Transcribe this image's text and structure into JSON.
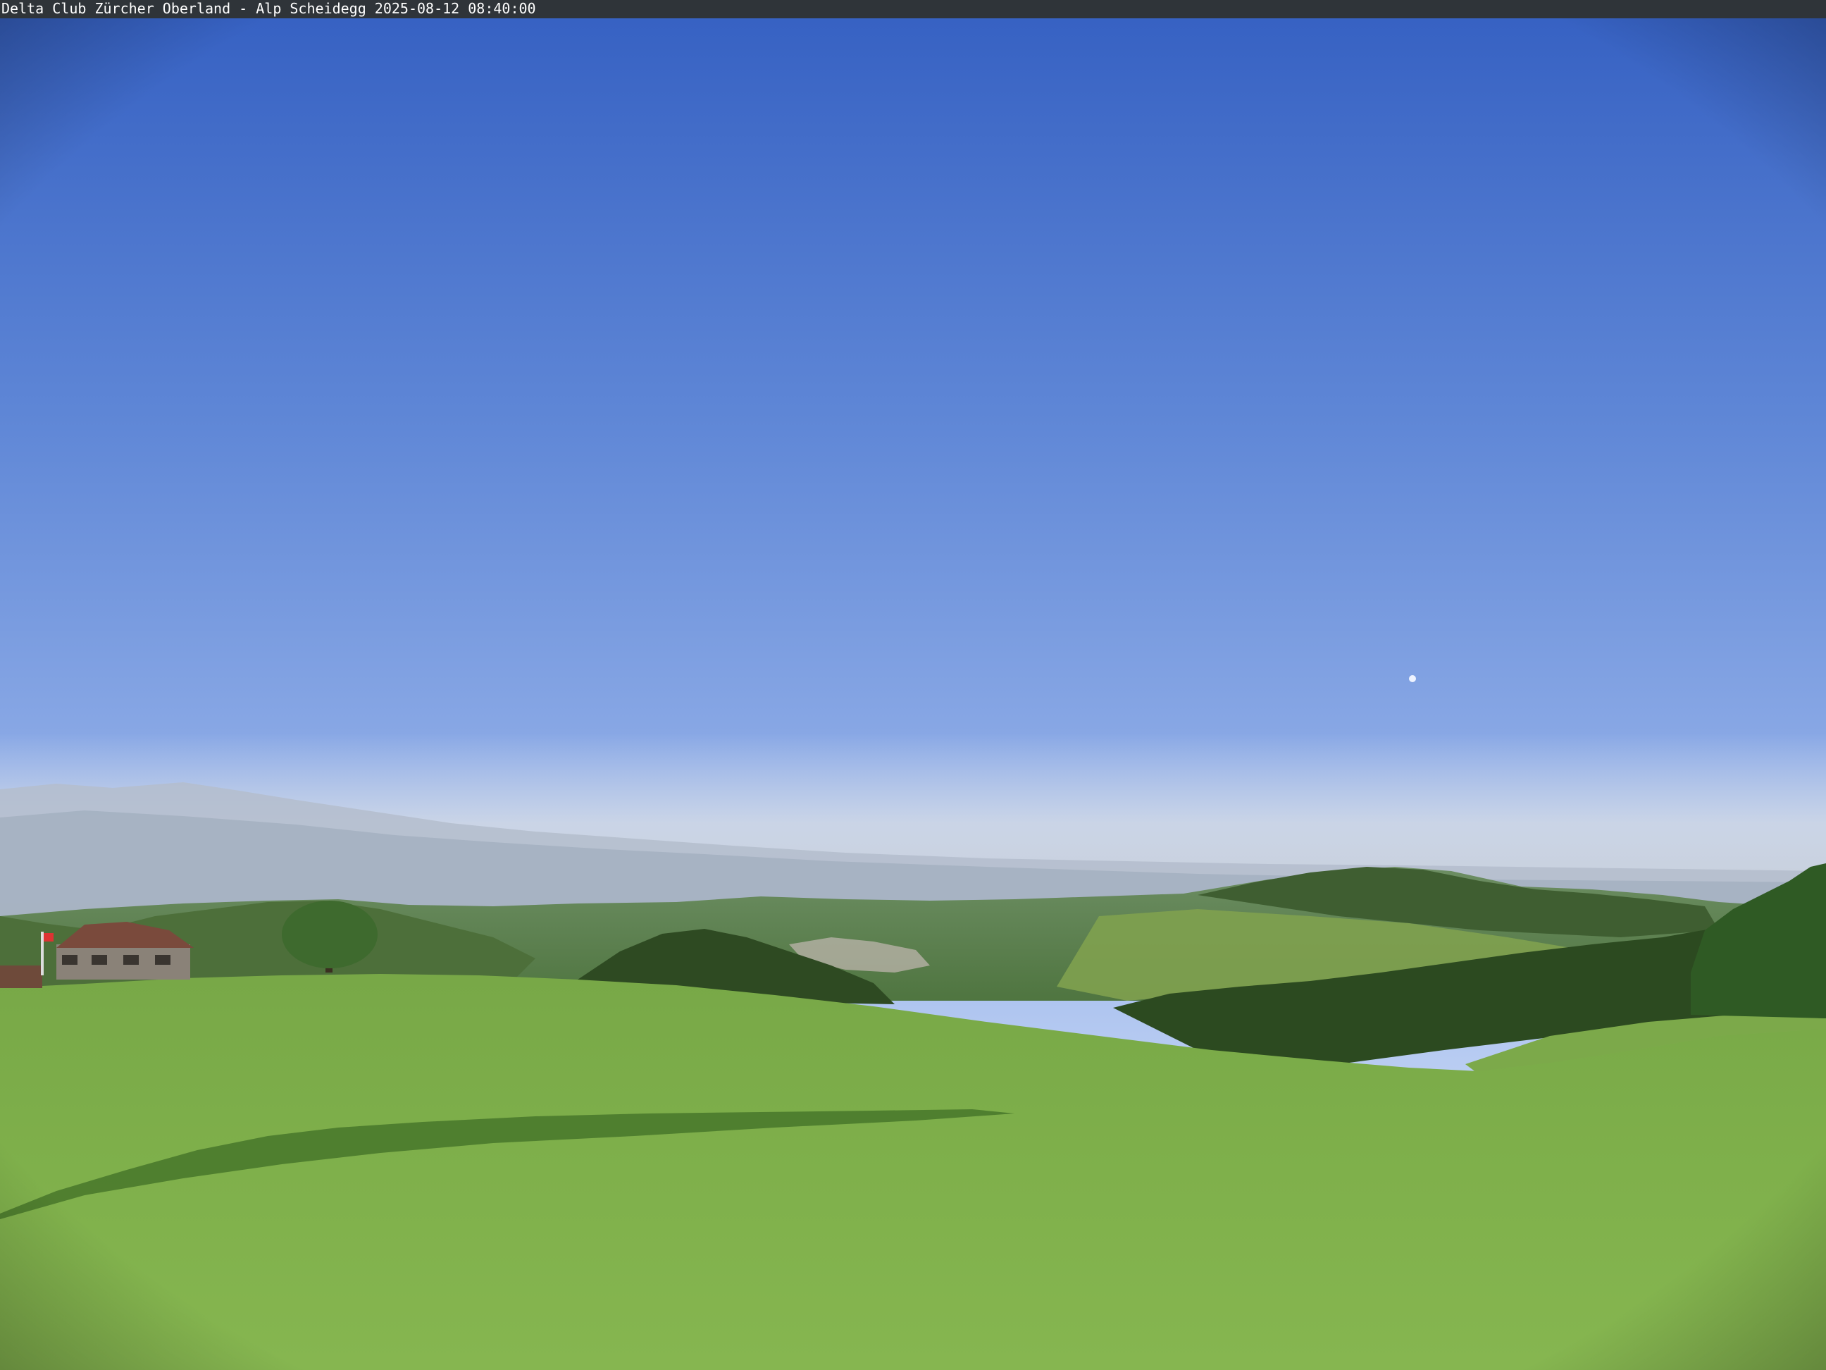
{
  "caption": {
    "text": "Delta Club Zürcher Oberland - Alp Scheidegg 2025-08-12 08:40:00"
  },
  "scene": {
    "description_free": true,
    "colors": {
      "sky_top": "#3a66c4",
      "sky_mid": "#7d9fdf",
      "sky_horizon": "#d6e2f7",
      "haze": "#c9d2e0",
      "distant_mountains": "#aeb8c8",
      "far_hills": "#6f8f6a",
      "forest_dark": "#2f4a22",
      "meadow_far": "#7dab48",
      "meadow_near": "#7eb24a",
      "shadow": "#3f6a24",
      "chalet_roof": "#7a4a3c",
      "chalet_wall": "#a9a49a",
      "caption_bar": "#2f3439",
      "caption_text": "#ffffff"
    }
  }
}
